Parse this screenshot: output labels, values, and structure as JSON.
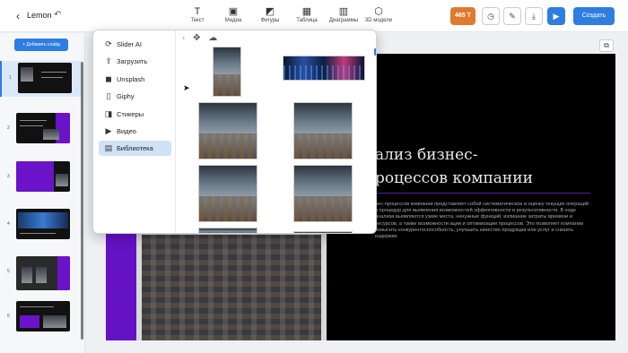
{
  "header": {
    "back_icon": "chevron-left-icon",
    "project_name": "Lemon",
    "undo_icon": "undo-icon",
    "tools": [
      {
        "label": "Текст",
        "icon": "text-icon",
        "glyph": "T"
      },
      {
        "label": "Медиа",
        "icon": "image-icon",
        "glyph": "▣"
      },
      {
        "label": "Фигуры",
        "icon": "shapes-icon",
        "glyph": "◩"
      },
      {
        "label": "Таблица",
        "icon": "table-icon",
        "glyph": "▦"
      },
      {
        "label": "Диаграммы",
        "icon": "chart-icon",
        "glyph": "▥"
      },
      {
        "label": "3D модели",
        "icon": "cube-icon",
        "glyph": "⬡"
      }
    ],
    "active_tool": "Медиа",
    "counter": "465 T",
    "create_label": "Создать",
    "accent_color": "#2e7de0"
  },
  "sidebar": {
    "add_slide_label": "+ Добавить слайд",
    "slides": [
      {
        "number": "1",
        "selected": true
      },
      {
        "number": "2",
        "selected": false
      },
      {
        "number": "3",
        "selected": false
      },
      {
        "number": "4",
        "selected": false
      },
      {
        "number": "5",
        "selected": false
      },
      {
        "number": "6",
        "selected": false
      }
    ]
  },
  "slide": {
    "title": "ализ бизнес-\nроцессов компании",
    "body": "нес-процессов компании представляет собой систематическое и оценку текущих операций и процедур для выявления возможностей эффективности и результативности. В ходе анализа выявляются узкие места, ненужные функций, излишние затраты времени и ресурсов, а также возможности ации и оптимизации процессов. Это позволяет компании повысить конкурентоспособность, улучшить качество продукции или услуг и снизить издержки.",
    "purple_color": "#6412c4"
  },
  "media_popup": {
    "menu": [
      {
        "label": "Slider AI",
        "icon": "ai-icon",
        "glyph": "⟳"
      },
      {
        "label": "Загрузить",
        "icon": "upload-icon",
        "glyph": "⇪"
      },
      {
        "label": "Unsplash",
        "icon": "unsplash-icon",
        "glyph": "◼"
      },
      {
        "label": "Giphy",
        "icon": "giphy-icon",
        "glyph": "▯"
      },
      {
        "label": "Стикеры",
        "icon": "sticker-icon",
        "glyph": "◨"
      },
      {
        "label": "Видео",
        "icon": "video-icon",
        "glyph": "▶"
      },
      {
        "label": "Библиотека",
        "icon": "library-icon",
        "glyph": "▤"
      }
    ],
    "selected_item": "Библиотека",
    "gallery_tools": [
      "chevron-left-icon",
      "crop-add-icon",
      "cloud-upload-icon"
    ]
  }
}
